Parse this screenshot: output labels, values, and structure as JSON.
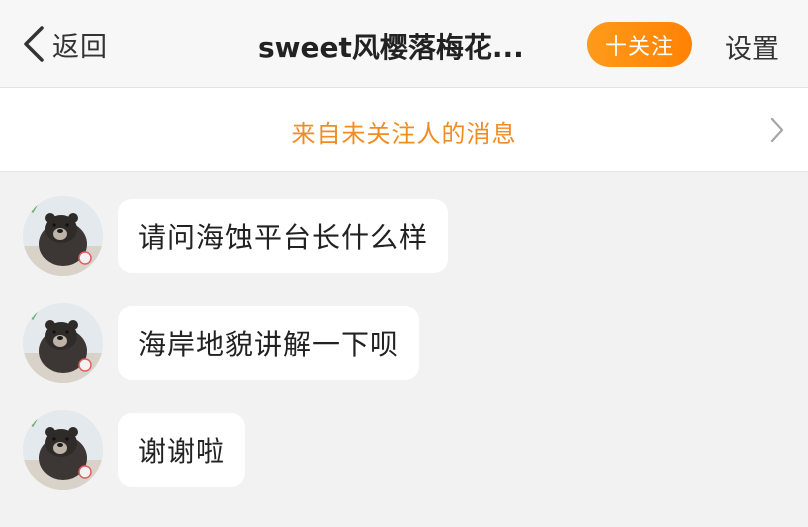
{
  "navbar": {
    "back_label": "返回",
    "title": "sweet风樱落梅花...",
    "follow_label": "十关注",
    "settings_label": "设置"
  },
  "notice": {
    "text": "来自未关注人的消息",
    "icon": "chevron-right-icon"
  },
  "messages": [
    {
      "text": "请问海蚀平台长什么样",
      "avatar": "bear-avatar"
    },
    {
      "text": "海岸地貌讲解一下呗",
      "avatar": "bear-avatar"
    },
    {
      "text": "谢谢啦",
      "avatar": "bear-avatar"
    }
  ],
  "colors": {
    "accent_orange": "#ff8c0f",
    "notice_text": "#f08c24",
    "background": "#f2f2f2"
  }
}
